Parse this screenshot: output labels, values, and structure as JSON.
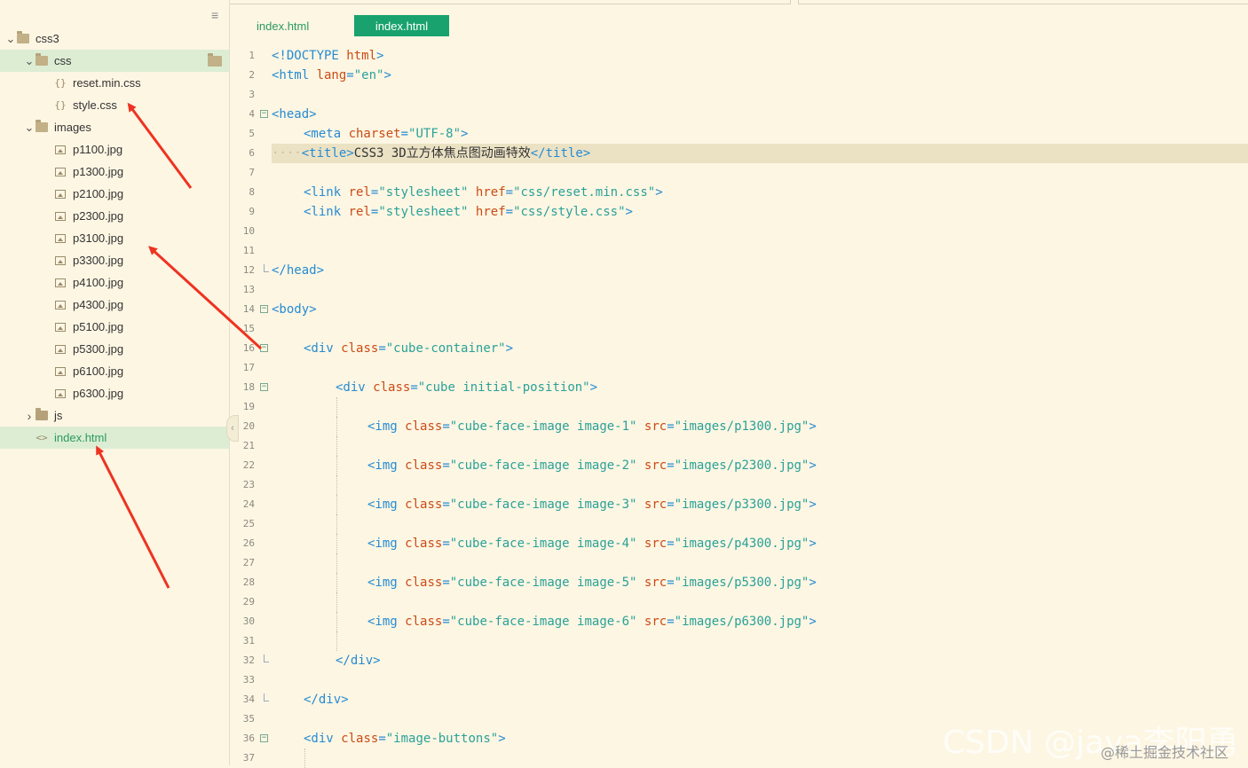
{
  "sidebar": {
    "menu_icon": "≡",
    "items": [
      {
        "label": "css3",
        "kind": "folder",
        "expanded": true,
        "depth": 0
      },
      {
        "label": "css",
        "kind": "folder",
        "expanded": true,
        "depth": 1,
        "selected": true
      },
      {
        "label": "reset.min.css",
        "kind": "css",
        "depth": 2
      },
      {
        "label": "style.css",
        "kind": "css",
        "depth": 2
      },
      {
        "label": "images",
        "kind": "folder",
        "expanded": true,
        "depth": 1
      },
      {
        "label": "p1100.jpg",
        "kind": "image",
        "depth": 2
      },
      {
        "label": "p1300.jpg",
        "kind": "image",
        "depth": 2
      },
      {
        "label": "p2100.jpg",
        "kind": "image",
        "depth": 2
      },
      {
        "label": "p2300.jpg",
        "kind": "image",
        "depth": 2
      },
      {
        "label": "p3100.jpg",
        "kind": "image",
        "depth": 2
      },
      {
        "label": "p3300.jpg",
        "kind": "image",
        "depth": 2
      },
      {
        "label": "p4100.jpg",
        "kind": "image",
        "depth": 2
      },
      {
        "label": "p4300.jpg",
        "kind": "image",
        "depth": 2
      },
      {
        "label": "p5100.jpg",
        "kind": "image",
        "depth": 2
      },
      {
        "label": "p5300.jpg",
        "kind": "image",
        "depth": 2
      },
      {
        "label": "p6100.jpg",
        "kind": "image",
        "depth": 2
      },
      {
        "label": "p6300.jpg",
        "kind": "image",
        "depth": 2
      },
      {
        "label": "js",
        "kind": "folder",
        "expanded": false,
        "depth": 1
      },
      {
        "label": "index.html",
        "kind": "html",
        "depth": 1,
        "selected": true
      }
    ],
    "collapse_glyph": "‹"
  },
  "editor": {
    "tabs": [
      {
        "label": "index.html",
        "active": false
      },
      {
        "label": "index.html",
        "active": true
      }
    ],
    "highlighted_line": 6,
    "lines": [
      {
        "n": "1",
        "indent": 0,
        "tokens": [
          [
            "tag",
            "<!DOCTYPE "
          ],
          [
            "attr",
            "html"
          ],
          [
            "tag",
            ">"
          ]
        ]
      },
      {
        "n": "2",
        "indent": 0,
        "tokens": [
          [
            "tag",
            "<html "
          ],
          [
            "attr",
            "lang"
          ],
          [
            "tag",
            "="
          ],
          [
            "str",
            "\"en\""
          ],
          [
            "tag",
            ">"
          ]
        ]
      },
      {
        "n": "3",
        "indent": 0,
        "tokens": []
      },
      {
        "n": "4",
        "indent": 0,
        "fold": "open",
        "tokens": [
          [
            "tag",
            "<head>"
          ]
        ]
      },
      {
        "n": "5",
        "indent": 1,
        "tokens": [
          [
            "tag",
            "<meta "
          ],
          [
            "attr",
            "charset"
          ],
          [
            "tag",
            "="
          ],
          [
            "str",
            "\"UTF-8\""
          ],
          [
            "tag",
            ">"
          ]
        ]
      },
      {
        "n": "6",
        "indent": 1,
        "dots": "····",
        "tokens": [
          [
            "tag",
            "<title>"
          ],
          [
            "txt",
            "CSS3 3D立方体焦点图动画特效"
          ],
          [
            "tag",
            "</title>"
          ]
        ]
      },
      {
        "n": "7",
        "indent": 0,
        "tokens": []
      },
      {
        "n": "8",
        "indent": 1,
        "tokens": [
          [
            "tag",
            "<link "
          ],
          [
            "attr",
            "rel"
          ],
          [
            "tag",
            "="
          ],
          [
            "str",
            "\"stylesheet\""
          ],
          [
            "tag",
            " "
          ],
          [
            "attr",
            "href"
          ],
          [
            "tag",
            "="
          ],
          [
            "str",
            "\"css/reset.min.css\""
          ],
          [
            "tag",
            ">"
          ]
        ]
      },
      {
        "n": "9",
        "indent": 1,
        "tokens": [
          [
            "tag",
            "<link "
          ],
          [
            "attr",
            "rel"
          ],
          [
            "tag",
            "="
          ],
          [
            "str",
            "\"stylesheet\""
          ],
          [
            "tag",
            " "
          ],
          [
            "attr",
            "href"
          ],
          [
            "tag",
            "="
          ],
          [
            "str",
            "\"css/style.css\""
          ],
          [
            "tag",
            ">"
          ]
        ]
      },
      {
        "n": "10",
        "indent": 0,
        "tokens": []
      },
      {
        "n": "11",
        "indent": 0,
        "tokens": []
      },
      {
        "n": "12",
        "indent": 0,
        "fold": "end",
        "tokens": [
          [
            "tag",
            "</head>"
          ]
        ]
      },
      {
        "n": "13",
        "indent": 0,
        "tokens": []
      },
      {
        "n": "14",
        "indent": 0,
        "fold": "open",
        "tokens": [
          [
            "tag",
            "<body>"
          ]
        ]
      },
      {
        "n": "15",
        "indent": 0,
        "tokens": []
      },
      {
        "n": "16",
        "indent": 1,
        "fold": "open",
        "tokens": [
          [
            "tag",
            "<div "
          ],
          [
            "attr",
            "class"
          ],
          [
            "tag",
            "="
          ],
          [
            "str",
            "\"cube-container\""
          ],
          [
            "tag",
            ">"
          ]
        ]
      },
      {
        "n": "17",
        "indent": 0,
        "tokens": []
      },
      {
        "n": "18",
        "indent": 2,
        "fold": "open",
        "tokens": [
          [
            "tag",
            "<div "
          ],
          [
            "attr",
            "class"
          ],
          [
            "tag",
            "="
          ],
          [
            "str",
            "\"cube initial-position\""
          ],
          [
            "tag",
            ">"
          ]
        ]
      },
      {
        "n": "19",
        "indent": 0,
        "guide": true,
        "tokens": []
      },
      {
        "n": "20",
        "indent": 3,
        "guide": true,
        "tokens": [
          [
            "tag",
            "<img "
          ],
          [
            "attr",
            "class"
          ],
          [
            "tag",
            "="
          ],
          [
            "str",
            "\"cube-face-image image-1\""
          ],
          [
            "tag",
            " "
          ],
          [
            "attr",
            "src"
          ],
          [
            "tag",
            "="
          ],
          [
            "str",
            "\"images/p1300.jpg\""
          ],
          [
            "tag",
            ">"
          ]
        ]
      },
      {
        "n": "21",
        "indent": 0,
        "guide": true,
        "tokens": []
      },
      {
        "n": "22",
        "indent": 3,
        "guide": true,
        "tokens": [
          [
            "tag",
            "<img "
          ],
          [
            "attr",
            "class"
          ],
          [
            "tag",
            "="
          ],
          [
            "str",
            "\"cube-face-image image-2\""
          ],
          [
            "tag",
            " "
          ],
          [
            "attr",
            "src"
          ],
          [
            "tag",
            "="
          ],
          [
            "str",
            "\"images/p2300.jpg\""
          ],
          [
            "tag",
            ">"
          ]
        ]
      },
      {
        "n": "23",
        "indent": 0,
        "guide": true,
        "tokens": []
      },
      {
        "n": "24",
        "indent": 3,
        "guide": true,
        "tokens": [
          [
            "tag",
            "<img "
          ],
          [
            "attr",
            "class"
          ],
          [
            "tag",
            "="
          ],
          [
            "str",
            "\"cube-face-image image-3\""
          ],
          [
            "tag",
            " "
          ],
          [
            "attr",
            "src"
          ],
          [
            "tag",
            "="
          ],
          [
            "str",
            "\"images/p3300.jpg\""
          ],
          [
            "tag",
            ">"
          ]
        ]
      },
      {
        "n": "25",
        "indent": 0,
        "guide": true,
        "tokens": []
      },
      {
        "n": "26",
        "indent": 3,
        "guide": true,
        "tokens": [
          [
            "tag",
            "<img "
          ],
          [
            "attr",
            "class"
          ],
          [
            "tag",
            "="
          ],
          [
            "str",
            "\"cube-face-image image-4\""
          ],
          [
            "tag",
            " "
          ],
          [
            "attr",
            "src"
          ],
          [
            "tag",
            "="
          ],
          [
            "str",
            "\"images/p4300.jpg\""
          ],
          [
            "tag",
            ">"
          ]
        ]
      },
      {
        "n": "27",
        "indent": 0,
        "guide": true,
        "tokens": []
      },
      {
        "n": "28",
        "indent": 3,
        "guide": true,
        "tokens": [
          [
            "tag",
            "<img "
          ],
          [
            "attr",
            "class"
          ],
          [
            "tag",
            "="
          ],
          [
            "str",
            "\"cube-face-image image-5\""
          ],
          [
            "tag",
            " "
          ],
          [
            "attr",
            "src"
          ],
          [
            "tag",
            "="
          ],
          [
            "str",
            "\"images/p5300.jpg\""
          ],
          [
            "tag",
            ">"
          ]
        ]
      },
      {
        "n": "29",
        "indent": 0,
        "guide": true,
        "tokens": []
      },
      {
        "n": "30",
        "indent": 3,
        "guide": true,
        "tokens": [
          [
            "tag",
            "<img "
          ],
          [
            "attr",
            "class"
          ],
          [
            "tag",
            "="
          ],
          [
            "str",
            "\"cube-face-image image-6\""
          ],
          [
            "tag",
            " "
          ],
          [
            "attr",
            "src"
          ],
          [
            "tag",
            "="
          ],
          [
            "str",
            "\"images/p6300.jpg\""
          ],
          [
            "tag",
            ">"
          ]
        ]
      },
      {
        "n": "31",
        "indent": 0,
        "guide": true,
        "tokens": []
      },
      {
        "n": "32",
        "indent": 2,
        "fold": "end",
        "tokens": [
          [
            "tag",
            "</div>"
          ]
        ]
      },
      {
        "n": "33",
        "indent": 0,
        "tokens": []
      },
      {
        "n": "34",
        "indent": 1,
        "fold": "end",
        "tokens": [
          [
            "tag",
            "</div>"
          ]
        ]
      },
      {
        "n": "35",
        "indent": 0,
        "tokens": []
      },
      {
        "n": "36",
        "indent": 1,
        "fold": "open",
        "tokens": [
          [
            "tag",
            "<div "
          ],
          [
            "attr",
            "class"
          ],
          [
            "tag",
            "="
          ],
          [
            "str",
            "\"image-buttons\""
          ],
          [
            "tag",
            ">"
          ]
        ]
      },
      {
        "n": "37",
        "indent": 0,
        "guide2": true,
        "tokens": []
      }
    ]
  },
  "colors": {
    "background": "#fdf6e3",
    "selection": "#dcedd4",
    "active_tab": "#19a26d",
    "arrow": "#ee3322",
    "tag": "#268bd2",
    "attr": "#cb4b16",
    "string": "#2aa198"
  },
  "watermarks": {
    "csdn": "CSDN @java李阳勇",
    "juejin": "@稀土掘金技术社区"
  }
}
